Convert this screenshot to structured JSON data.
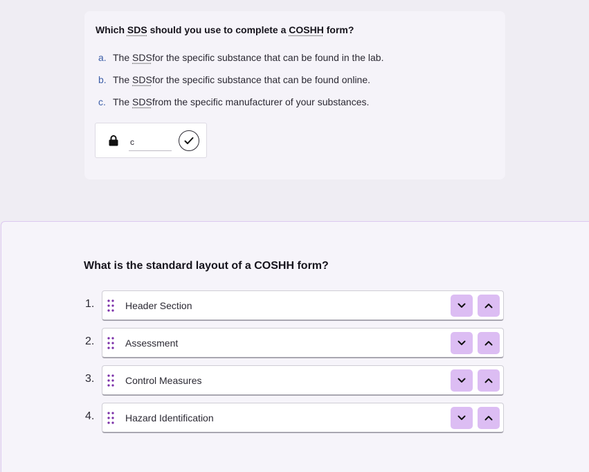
{
  "question1": {
    "prefix": "Which ",
    "abbr1": "SDS",
    "middle": " should you use to complete a ",
    "abbr2": "COSHH",
    "suffix": " form?",
    "options": [
      {
        "letter": "a.",
        "before": "The ",
        "abbr": "SDS",
        "after": " for the specific substance that can be found in the lab."
      },
      {
        "letter": "b.",
        "before": "The ",
        "abbr": "SDS",
        "after": " for the specific substance that can be found online."
      },
      {
        "letter": "c.",
        "before": "The ",
        "abbr": "SDS",
        "after": " from the specific manufacturer of your substances."
      }
    ],
    "answer_value": "c",
    "icons": {
      "lock": "lock-icon",
      "submit": "checkmark-icon"
    }
  },
  "question2": {
    "title": "What is the standard layout of a COSHH form?",
    "items": [
      {
        "number": "1.",
        "label": "Header Section"
      },
      {
        "number": "2.",
        "label": "Assessment"
      },
      {
        "number": "3.",
        "label": "Control Measures"
      },
      {
        "number": "4.",
        "label": "Hazard Identification"
      }
    ],
    "icons": {
      "drag": "drag-handle-icon",
      "down": "chevron-down-icon",
      "up": "chevron-up-icon"
    },
    "colors": {
      "button_bg": "#dcbdf3",
      "grip": "#7b2fa8"
    }
  }
}
